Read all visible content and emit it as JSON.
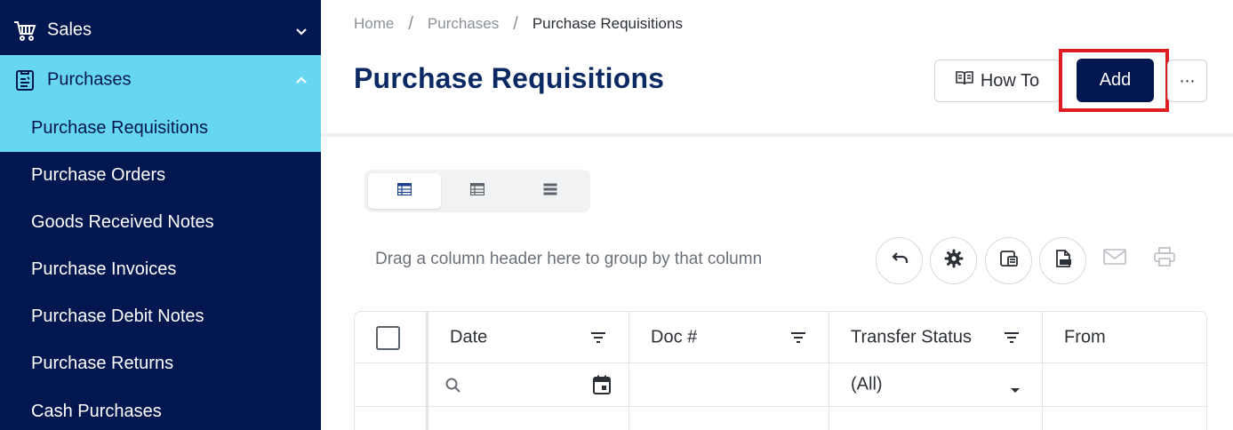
{
  "sidebar": {
    "groups": [
      {
        "label": "Sales",
        "icon": "cart-icon",
        "expanded": false
      },
      {
        "label": "Purchases",
        "icon": "clipboard-icon",
        "expanded": true
      }
    ],
    "items": [
      {
        "label": "Purchase Requisitions",
        "active": true
      },
      {
        "label": "Purchase Orders"
      },
      {
        "label": "Goods Received Notes"
      },
      {
        "label": "Purchase Invoices"
      },
      {
        "label": "Purchase Debit Notes"
      },
      {
        "label": "Purchase Returns"
      },
      {
        "label": "Cash Purchases"
      }
    ]
  },
  "breadcrumb": [
    "Home",
    "Purchases",
    "Purchase Requisitions"
  ],
  "page": {
    "title": "Purchase Requisitions"
  },
  "actions": {
    "how_to": "How To",
    "add": "Add",
    "more": "⋯"
  },
  "grid": {
    "group_hint": "Drag a column header here to group by that column",
    "toolbar_icons": [
      "undo-icon",
      "settings-icon",
      "export-pdf-icon",
      "export-excel-icon",
      "email-icon",
      "print-icon"
    ],
    "columns": [
      "Date",
      "Doc #",
      "Transfer Status",
      "From"
    ],
    "filters": {
      "transfer_status": "(All)"
    }
  },
  "colors": {
    "sidebar_bg": "#021650",
    "active_bg": "#66d6f1",
    "title": "#0b2a63",
    "highlight": "#e11b22"
  }
}
